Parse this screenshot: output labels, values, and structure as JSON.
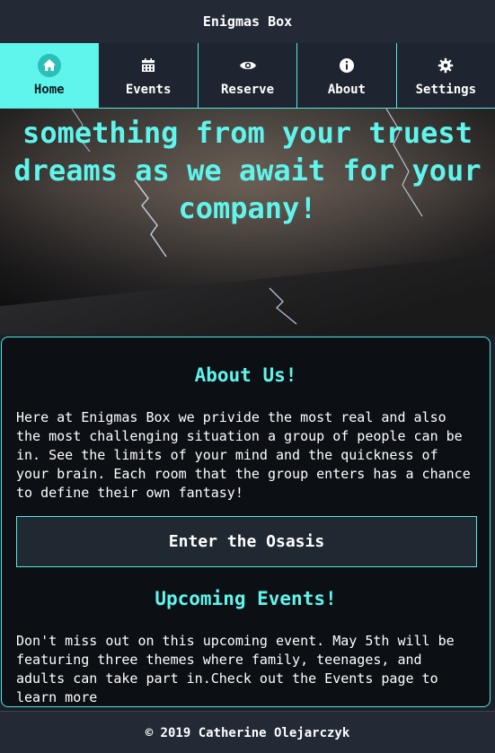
{
  "app": {
    "title": "Enigmas Box"
  },
  "nav": {
    "items": [
      {
        "label": "Home",
        "icon": "home-icon",
        "active": true
      },
      {
        "label": "Events",
        "icon": "calendar-icon"
      },
      {
        "label": "Reserve",
        "icon": "eye-icon"
      },
      {
        "label": "About",
        "icon": "info-icon"
      },
      {
        "label": "Settings",
        "icon": "gear-icon"
      }
    ]
  },
  "hero": {
    "line1": "something from your truest",
    "line2": "dreams as we await for your",
    "line3": "company!"
  },
  "about": {
    "heading": "About Us!",
    "body": "Here at Enigmas Box we privide the most real and also the most challenging situation a group of people can be in. See the limits of your mind and the quickness of your brain. Each room that the group enters has a chance to define their own fantasy!",
    "button_label": "Enter the Osasis"
  },
  "events": {
    "heading": "Upcoming Events!",
    "body": "Don't miss out on this upcoming event. May 5th will be featuring three themes where family, teenages, and adults can take part in.Check out the Events page to learn more"
  },
  "footer": {
    "text": "© 2019 Catherine Olejarczyk"
  },
  "colors": {
    "accent": "#5ff5ec",
    "background": "#1a1f2a",
    "card": "#0c0f14"
  }
}
